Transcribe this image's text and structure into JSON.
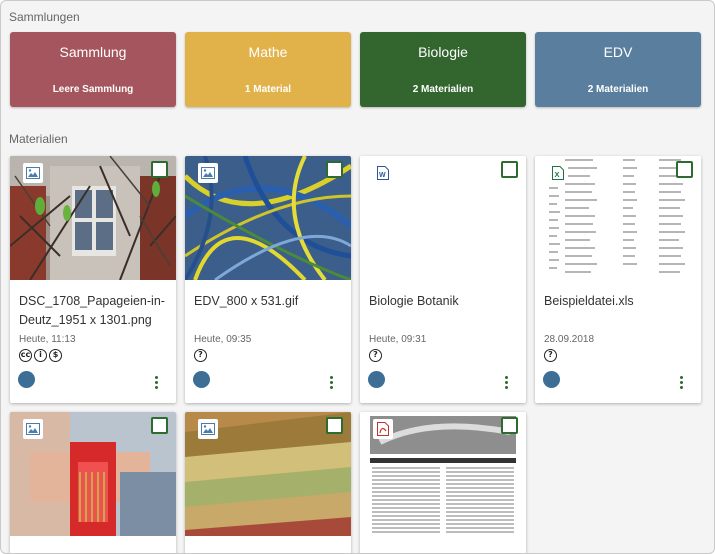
{
  "sections": {
    "collections": "Sammlungen",
    "materials": "Materialien"
  },
  "collections": [
    {
      "title": "Sammlung",
      "subtitle": "Leere Sammlung",
      "color": "#a5555e"
    },
    {
      "title": "Mathe",
      "subtitle": "1 Material",
      "color": "#e2b24a"
    },
    {
      "title": "Biologie",
      "subtitle": "2 Materialien",
      "color": "#33662f"
    },
    {
      "title": "EDV",
      "subtitle": "2 Materialien",
      "color": "#5a7f9e"
    }
  ],
  "materials": [
    {
      "title": "DSC_1708_Papageien-in-Deutz_1951 x 1301.png",
      "date": "Heute, 11:13",
      "license": "cc-by-nc",
      "type_icon": "image-icon"
    },
    {
      "title": "EDV_800 x 531.gif",
      "date": "Heute, 09:35",
      "license": "unknown",
      "type_icon": "image-icon"
    },
    {
      "title": "Biologie Botanik",
      "date": "Heute, 09:31",
      "license": "unknown",
      "type_icon": "word-icon"
    },
    {
      "title": "Beispieldatei.xls",
      "date": "28.09.2018",
      "license": "unknown",
      "type_icon": "excel-icon"
    },
    {
      "title": "",
      "date": "",
      "type_icon": "image-icon"
    },
    {
      "title": "",
      "date": "",
      "type_icon": "image-icon"
    },
    {
      "title": "",
      "date": "",
      "type_icon": "pdf-icon"
    }
  ],
  "license_glyphs": {
    "cc": "cc",
    "by": "i",
    "nc": "$",
    "unknown": "?"
  },
  "colors": {
    "accent": "#2e6b30",
    "share": "#3c6e96"
  }
}
